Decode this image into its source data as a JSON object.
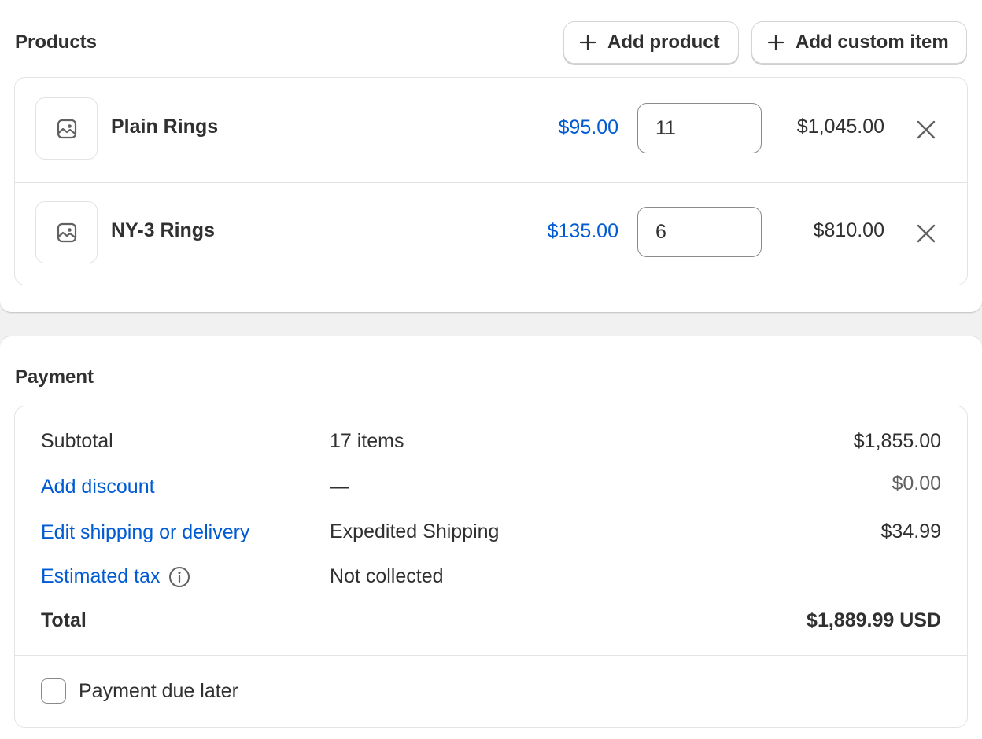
{
  "products": {
    "title": "Products",
    "add_product_label": "Add product",
    "add_custom_item_label": "Add custom item",
    "items": [
      {
        "name": "Plain Rings",
        "price": "$95.00",
        "quantity": "11",
        "line_total": "$1,045.00"
      },
      {
        "name": "NY-3 Rings",
        "price": "$135.00",
        "quantity": "6",
        "line_total": "$810.00"
      }
    ]
  },
  "payment": {
    "title": "Payment",
    "subtotal": {
      "label": "Subtotal",
      "detail": "17 items",
      "amount": "$1,855.00"
    },
    "discount": {
      "label": "Add discount",
      "detail": "—",
      "amount": "$0.00"
    },
    "shipping": {
      "label": "Edit shipping or delivery",
      "detail": "Expedited Shipping",
      "amount": "$34.99"
    },
    "tax": {
      "label": "Estimated tax",
      "detail": "Not collected"
    },
    "total": {
      "label": "Total",
      "amount": "$1,889.99 USD"
    },
    "payment_due_later": {
      "label": "Payment due later",
      "checked": false
    }
  },
  "colors": {
    "link": "#005bd3",
    "text": "#303030",
    "border": "#e3e3e3",
    "background": "#f1f1f1"
  },
  "icons": {
    "add": "plus-icon",
    "product_thumb": "image-placeholder-icon",
    "remove": "close-icon",
    "tax_info": "info-icon"
  }
}
